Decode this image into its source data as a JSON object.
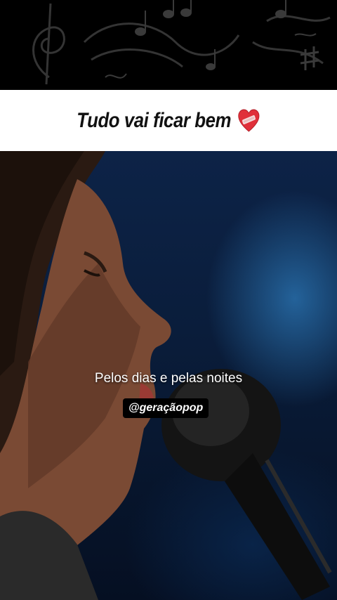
{
  "header": {
    "title": "Tudo vai ficar bem",
    "title_icon": "mending-heart-icon"
  },
  "video": {
    "subtitle": "Pelos dias e pelas noites",
    "watermark": "@geraçãopop"
  },
  "colors": {
    "banner_bg": "#000000",
    "title_bg": "#ffffff",
    "heart": "#e0303a"
  }
}
